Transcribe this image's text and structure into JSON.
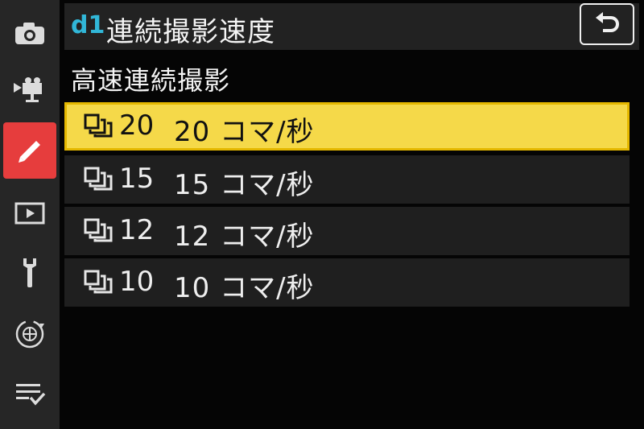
{
  "header": {
    "code": "d1",
    "title": "連続撮影速度"
  },
  "subtitle": "高速連続撮影",
  "options": [
    {
      "fps": "20",
      "label": "20 コマ/秒",
      "selected": true
    },
    {
      "fps": "15",
      "label": "15 コマ/秒",
      "selected": false
    },
    {
      "fps": "12",
      "label": "12 コマ/秒",
      "selected": false
    },
    {
      "fps": "10",
      "label": "10 コマ/秒",
      "selected": false
    }
  ],
  "sidebar": {
    "items": [
      {
        "icon": "camera-icon"
      },
      {
        "icon": "movie-camera-icon"
      },
      {
        "icon": "pencil-icon",
        "active": true
      },
      {
        "icon": "playback-icon"
      },
      {
        "icon": "wrench-icon"
      },
      {
        "icon": "network-icon"
      },
      {
        "icon": "my-menu-icon"
      }
    ]
  },
  "colors": {
    "accent": "#e63d3d",
    "highlight": "#f5d949",
    "code": "#31b7d8"
  }
}
